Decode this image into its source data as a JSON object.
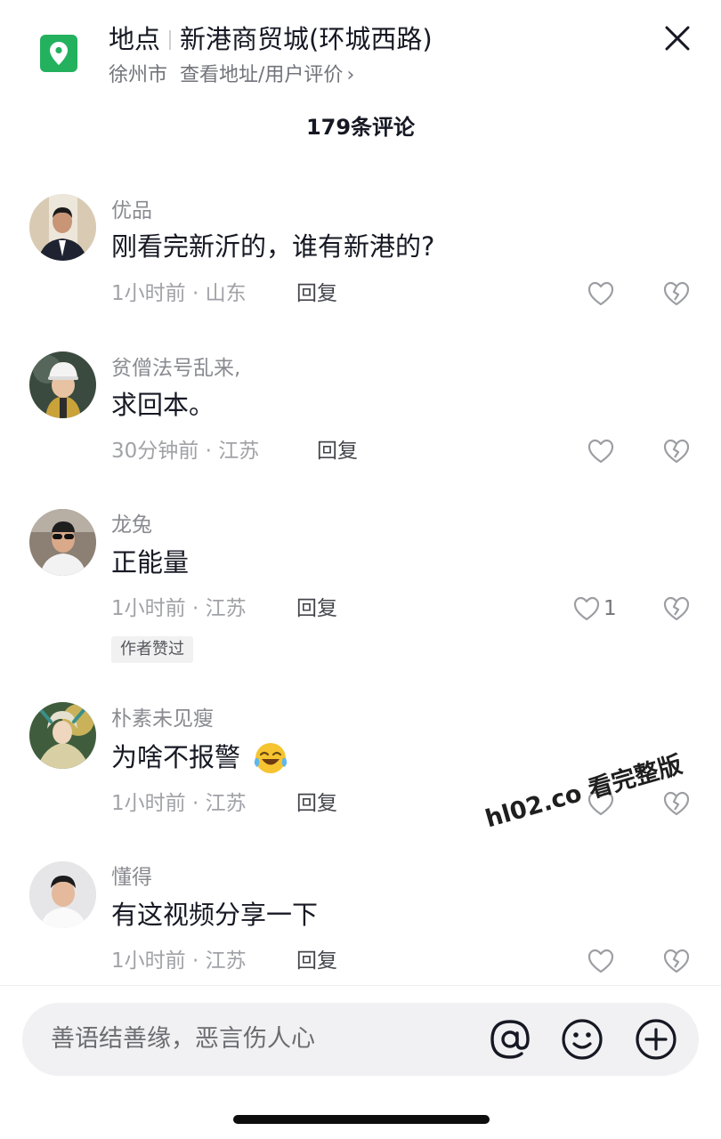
{
  "header": {
    "type_label": "地点",
    "place_name": "新港商贸城(环城西路)",
    "city": "徐州市",
    "detail_link": "查看地址/用户评价",
    "chevron": "›"
  },
  "comment_count": "179条评论",
  "comments": [
    {
      "name": "优品",
      "text": "刚看完新沂的，谁有新港的?",
      "meta": "1小时前 · 山东",
      "reply": "回复",
      "likes": ""
    },
    {
      "name": "贫僧法号乱来,",
      "text": "求回本。",
      "meta": "30分钟前 · 江苏",
      "reply": "回复",
      "likes": ""
    },
    {
      "name": "龙兔",
      "text": "正能量",
      "meta": "1小时前 · 江苏",
      "reply": "回复",
      "likes": "1",
      "badge": "作者赞过"
    },
    {
      "name": "朴素未见瘦",
      "text": "为啥不报警",
      "meta": "1小时前 · 江苏",
      "reply": "回复",
      "likes": ""
    },
    {
      "name": "懂得",
      "text": "有这视频分享一下",
      "meta": "1小时前 · 江苏",
      "reply": "回复",
      "likes": ""
    }
  ],
  "watermark": "hl02.co 看完整版",
  "input": {
    "placeholder": "善语结善缘，恶言伤人心"
  },
  "icons": {
    "location": "location-pin-icon",
    "close": "close-icon",
    "like": "heart-icon",
    "dislike": "broken-heart-icon",
    "at": "at-icon",
    "emoji": "emoji-icon",
    "plus": "plus-circle-icon"
  },
  "colors": {
    "accent_green": "#23b15e",
    "text_primary": "#161823",
    "text_secondary": "#8a8b91"
  }
}
